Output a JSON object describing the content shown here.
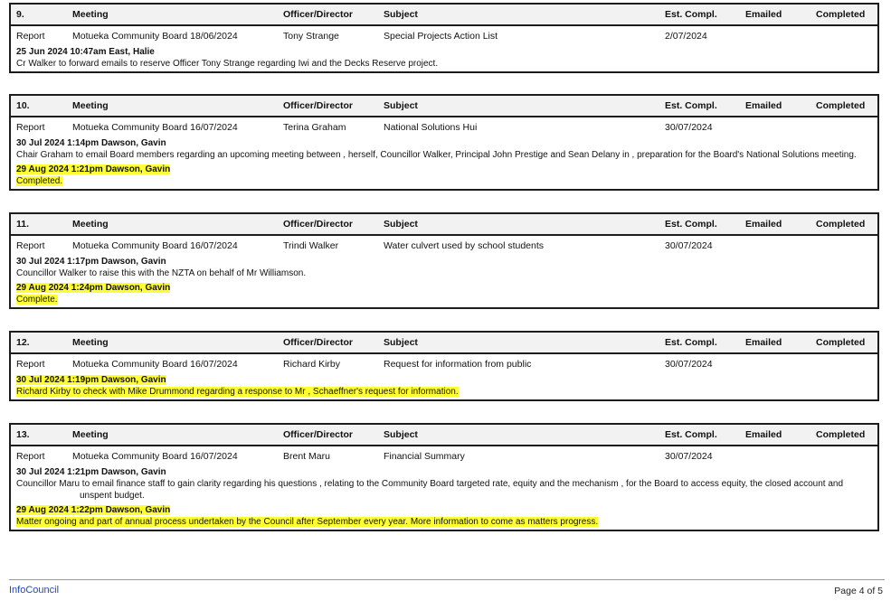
{
  "headers": {
    "meeting": "Meeting",
    "officer": "Officer/Director",
    "subject": "Subject",
    "est_compl": "Est. Compl.",
    "emailed": "Emailed",
    "completed": "Completed"
  },
  "items": [
    {
      "no": "9.",
      "type": "Report",
      "meeting": "Motueka Community Board 18/06/2024",
      "officer": "Tony Strange",
      "subject": "Special Projects Action List",
      "est": "2/07/2024",
      "note1_head": "25 Jun 2024 10:47am East, Halie",
      "note1_text": "Cr Walker to forward emails to reserve Officer Tony Strange regarding Iwi and the Decks Reserve project."
    },
    {
      "no": "10.",
      "type": "Report",
      "meeting": "Motueka Community Board 16/07/2024",
      "officer": "Terina  Graham",
      "subject": "National Solutions Hui",
      "est": "30/07/2024",
      "note1_head": "30 Jul 2024 1:14pm Dawson, Gavin",
      "note1_text": "Chair Graham to email Board members regarding an upcoming meeting between , herself, Councillor Walker, Principal John Prestige and Sean Delany in , preparation for the Board's National Solutions meeting.",
      "note2_head": "29 Aug 2024 1:21pm Dawson, Gavin",
      "note2_text": "Completed."
    },
    {
      "no": "11.",
      "type": "Report",
      "meeting": "Motueka Community Board 16/07/2024",
      "officer": "Trindi  Walker",
      "subject": "Water culvert used by school students",
      "est": "30/07/2024",
      "note1_head": "30 Jul 2024 1:17pm Dawson, Gavin",
      "note1_text": "Councillor Walker to raise this with the NZTA on behalf of Mr Williamson.",
      "note2_head": "29 Aug 2024 1:24pm Dawson, Gavin",
      "note2_text": "Complete."
    },
    {
      "no": "12.",
      "type": "Report",
      "meeting": "Motueka Community Board 16/07/2024",
      "officer": "Richard Kirby",
      "subject": "Request for information from public",
      "est": "30/07/2024",
      "note1_head": "30 Jul 2024 1:19pm Dawson, Gavin",
      "note1_text": "Richard Kirby to check with Mike Drummond regarding a response to Mr , Schaeffner's request for information."
    },
    {
      "no": "13.",
      "type": "Report",
      "meeting": "Motueka Community Board 16/07/2024",
      "officer": "Brent Maru",
      "subject": "Financial Summary",
      "est": "30/07/2024",
      "note1_head": "30 Jul 2024 1:21pm Dawson, Gavin",
      "note1_text": "Councillor Maru to email finance staff to gain clarity regarding his questions , relating to the Community Board targeted rate, equity and the mechanism , for the Board to access equity, the closed account and unspent budget.",
      "note2_head": "29 Aug 2024 1:22pm Dawson, Gavin",
      "note2_text": "Matter ongoing and part of annual process undertaken by the Council after September every year. More information to come as matters progress."
    }
  ],
  "footer": {
    "brand": "InfoCouncil",
    "page": "Page 4 of 5"
  }
}
